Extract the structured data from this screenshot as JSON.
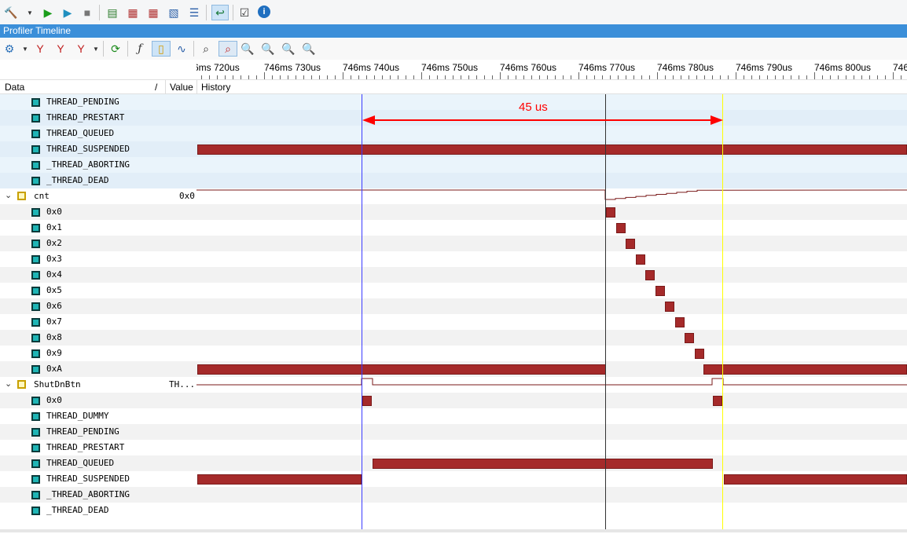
{
  "panel_title": "Profiler Timeline",
  "columns": {
    "data": "Data",
    "sort": "/",
    "value": "Value",
    "history": "History"
  },
  "ruler_labels": [
    "6ms 720us",
    "746ms 730us",
    "746ms 740us",
    "746ms 750us",
    "746ms 760us",
    "746ms 770us",
    "746ms 780us",
    "746ms 790us",
    "746ms 800us",
    "746"
  ],
  "measurement": {
    "label": "45 us"
  },
  "rows": [
    {
      "name": "THREAD_PENDING",
      "value": ""
    },
    {
      "name": "THREAD_PRESTART",
      "value": ""
    },
    {
      "name": "THREAD_QUEUED",
      "value": ""
    },
    {
      "name": "THREAD_SUSPENDED",
      "value": ""
    },
    {
      "name": "_THREAD_ABORTING",
      "value": ""
    },
    {
      "name": "_THREAD_DEAD",
      "value": ""
    },
    {
      "name": "cnt",
      "value": "0x0"
    },
    {
      "name": "0x0",
      "value": ""
    },
    {
      "name": "0x1",
      "value": ""
    },
    {
      "name": "0x2",
      "value": ""
    },
    {
      "name": "0x3",
      "value": ""
    },
    {
      "name": "0x4",
      "value": ""
    },
    {
      "name": "0x5",
      "value": ""
    },
    {
      "name": "0x6",
      "value": ""
    },
    {
      "name": "0x7",
      "value": ""
    },
    {
      "name": "0x8",
      "value": ""
    },
    {
      "name": "0x9",
      "value": ""
    },
    {
      "name": "0xA",
      "value": ""
    },
    {
      "name": "ShutDnBtn",
      "value": "TH..."
    },
    {
      "name": "0x0",
      "value": ""
    },
    {
      "name": "THREAD_DUMMY",
      "value": ""
    },
    {
      "name": "THREAD_PENDING",
      "value": ""
    },
    {
      "name": "THREAD_PRESTART",
      "value": ""
    },
    {
      "name": "THREAD_QUEUED",
      "value": ""
    },
    {
      "name": "THREAD_SUSPENDED",
      "value": ""
    },
    {
      "name": "_THREAD_ABORTING",
      "value": ""
    },
    {
      "name": "_THREAD_DEAD",
      "value": ""
    }
  ],
  "colors": {
    "bar": "#a52a2a",
    "cursor_blue": "#3b3bff",
    "cursor_black": "#333333",
    "cursor_yellow": "#ffff00",
    "arrow": "#ff0000",
    "title_bar": "#3b8fd9"
  },
  "toolbar_icons": [
    "hammer-icon",
    "run-icon",
    "step-icon",
    "stop-icon",
    "build-icon",
    "table-icon",
    "compare-icon",
    "export-icon",
    "list-icon",
    "timeline-icon",
    "check-icon",
    "info-icon"
  ],
  "timeline_toolbar_icons": [
    "settings-icon",
    "filter-icon",
    "filter-add-icon",
    "filter-remove-icon",
    "refresh-icon",
    "function-icon",
    "fit-icon",
    "wave-icon",
    "find-icon",
    "find-next-icon",
    "zoom-in-icon",
    "zoom-out-icon",
    "zoom-reset-icon",
    "zoom-fit-icon"
  ]
}
